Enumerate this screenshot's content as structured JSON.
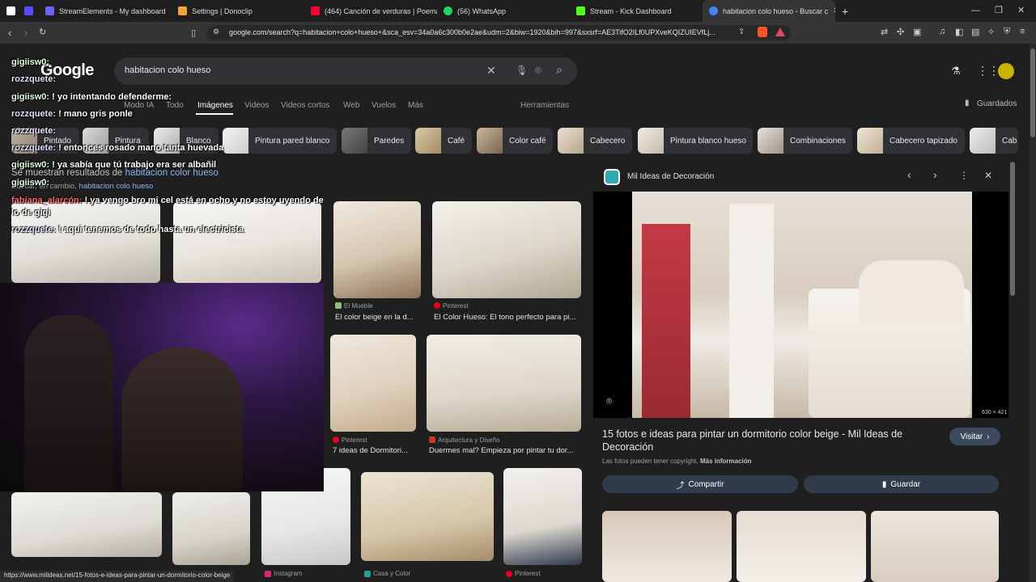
{
  "tabs": [
    {
      "label": "StreamElements - My dashboard",
      "color": "#6c63ff"
    },
    {
      "label": "Settings | Donoclip",
      "color": "#f2a33a"
    },
    {
      "label": "(464) Canción de verduras | Poemas",
      "color": "#ff0033"
    },
    {
      "label": "(56) WhatsApp",
      "color": "#25d366"
    },
    {
      "label": "Stream - Kick Dashboard",
      "color": "#53fc18"
    },
    {
      "label": "habitacion colo hueso - Buscar c",
      "color": "#4285f4"
    }
  ],
  "url": "google.com/search?q=habitacion+colo+hueso+&sca_esv=34a0a6c300b0e2ae&udm=2&biw=1920&bih=997&sxsrf=AE3TifO2ILf0UPXveKQIZUIEVfLj...",
  "search": {
    "query": "habitacion colo hueso"
  },
  "nav_tabs": [
    "Modo IA",
    "Todo",
    "Imágenes",
    "Videos",
    "Videos cortos",
    "Web",
    "Vuelos",
    "Más"
  ],
  "tools_label": "Herramientas",
  "saved_label": "Guardados",
  "chips": [
    "Pintado",
    "Pintura",
    "Blanco",
    "Pintura pared blanco",
    "Paredes",
    "Café",
    "Color café",
    "Cabecero",
    "Pintura blanco hueso",
    "Combinaciones",
    "Cabecero tapizado",
    "Cab"
  ],
  "correction": {
    "prefix": "Se muestran resultados de",
    "suggest": "habitacion color hueso",
    "alt_prefix": "Buscar, en cambio,",
    "alt": "habitacion colo hueso"
  },
  "results": [
    {
      "source": "El Mueble",
      "title": "El color beige en la d..."
    },
    {
      "source": "Pinterest",
      "title": "El Color Hueso: El tono perfecto para pi..."
    },
    {
      "source": "Pinterest",
      "title": "7 ideas de Dormitori..."
    },
    {
      "source": "Arquitectura y Diseño",
      "title": "Duermes mal? Empieza por pintar tu dor..."
    },
    {
      "source": "Instagram",
      "title": ""
    },
    {
      "source": "Casa y Color",
      "title": ""
    },
    {
      "source": "Pinterest",
      "title": ""
    }
  ],
  "chat": [
    {
      "user": "gigiisw0:",
      "msg": ""
    },
    {
      "user": "rozzquete:",
      "msg": ""
    },
    {
      "user": "gigiisw0:",
      "msg": "! yo intentando defenderme:"
    },
    {
      "user": "rozzquete:",
      "msg": "! mano gris ponle"
    },
    {
      "user": "rozzquete:",
      "msg": ""
    },
    {
      "user": "rozzquete:",
      "msg": "! entonces rosado mano tanta huevada"
    },
    {
      "user": "gigiisw0:",
      "msg": "! ya sabía que tú trabajo era ser albañil"
    },
    {
      "user": "gigiisw0:",
      "msg": ""
    },
    {
      "user": "fabiana_alarcón:",
      "msg": "! ya vengo bro mi cel está en ocho y no estoy uyendo de lo de gigi"
    },
    {
      "user": "rozzquete:",
      "msg": "! aqui tenemos de todo hasta un electricista"
    }
  ],
  "panel": {
    "site": "Mil Ideas de Decoración",
    "dims": "630 × 421",
    "title": "15 fotos e ideas para pintar un dormitorio color beige - Mil Ideas de Decoración",
    "copyright": "Las fotos pueden tener copyright.",
    "more_info": "Más información",
    "visit": "Visitar",
    "share": "Compartir",
    "save": "Guardar"
  },
  "status_url": "https://www.milideas.net/15-fotos-e-ideas-para-pintar-un-dormitorio-color-beige"
}
